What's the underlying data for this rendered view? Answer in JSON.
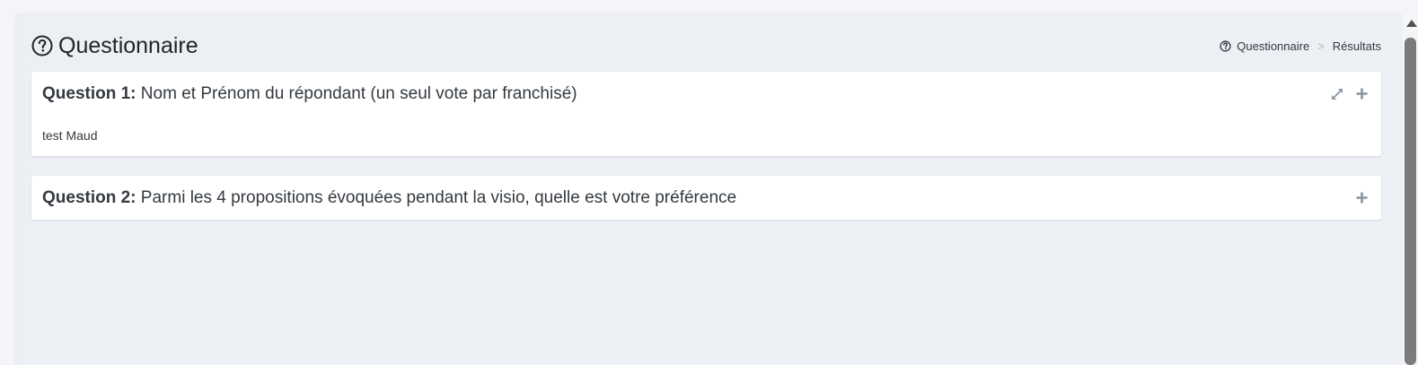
{
  "header": {
    "title": "Questionnaire",
    "icon": "question-circle-icon"
  },
  "breadcrumb": {
    "items": [
      "Questionnaire",
      "Résultats"
    ],
    "separator": ">",
    "icon": "question-circle-icon"
  },
  "questions": [
    {
      "label": "Question 1:",
      "text": "Nom et Prénom du répondant (un seul vote par franchisé)",
      "answer": "test Maud",
      "tools": [
        "expand-icon",
        "plus-icon"
      ]
    },
    {
      "label": "Question 2:",
      "text": "Parmi les 4 propositions évoquées pendant la visio, quelle est votre préférence",
      "tools": [
        "plus-icon"
      ]
    }
  ],
  "colors": {
    "background": "#eceff4",
    "card": "#ffffff",
    "text": "#343a40",
    "tool_icon": "#8a96a3"
  }
}
